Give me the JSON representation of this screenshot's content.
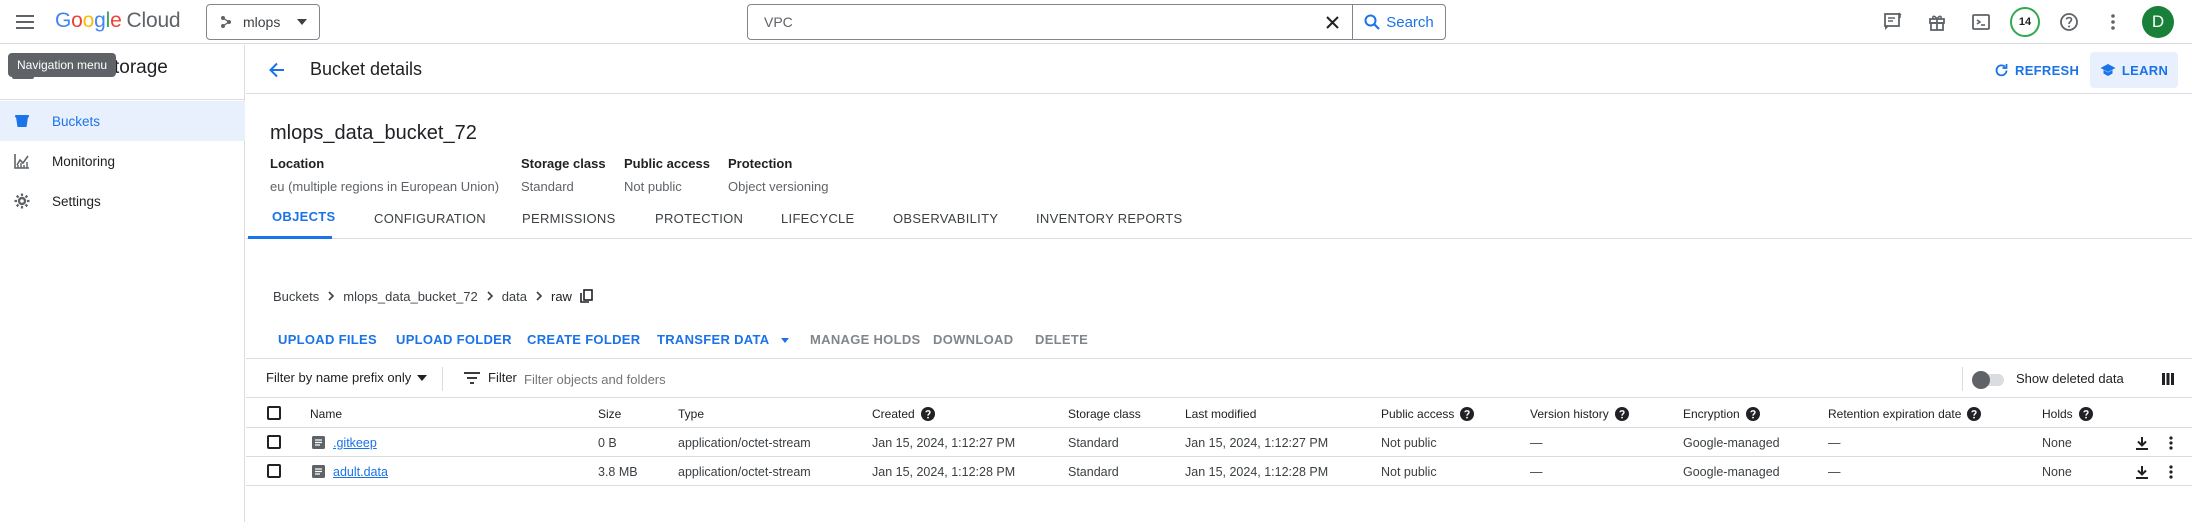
{
  "brand": {
    "google": [
      "G",
      "o",
      "o",
      "g",
      "l",
      "e"
    ],
    "product": "Cloud"
  },
  "project": {
    "name": "mlops"
  },
  "search": {
    "value": "VPC",
    "button_label": "Search"
  },
  "notifications": {
    "count": "14"
  },
  "user": {
    "initial": "D"
  },
  "tooltip": "Navigation menu",
  "sidebar": {
    "title": "Cloud Storage",
    "title_visible": "torage",
    "items": [
      {
        "label": "Buckets",
        "icon": "bucket-icon",
        "active": true
      },
      {
        "label": "Monitoring",
        "icon": "chart-icon",
        "active": false
      },
      {
        "label": "Settings",
        "icon": "gear-icon",
        "active": false
      }
    ]
  },
  "header": {
    "title": "Bucket details",
    "refresh_label": "REFRESH",
    "learn_label": "LEARN"
  },
  "bucket": {
    "name": "mlops_data_bucket_72",
    "location_label": "Location",
    "location_value": "eu (multiple regions in European Union)",
    "storage_class_label": "Storage class",
    "storage_class_value": "Standard",
    "public_access_label": "Public access",
    "public_access_value": "Not public",
    "protection_label": "Protection",
    "protection_value": "Object versioning"
  },
  "tabs": [
    "OBJECTS",
    "CONFIGURATION",
    "PERMISSIONS",
    "PROTECTION",
    "LIFECYCLE",
    "OBSERVABILITY",
    "INVENTORY REPORTS"
  ],
  "breadcrumb": [
    "Buckets",
    "mlops_data_bucket_72",
    "data",
    "raw"
  ],
  "actions": {
    "upload_files": "UPLOAD FILES",
    "upload_folder": "UPLOAD FOLDER",
    "create_folder": "CREATE FOLDER",
    "transfer_data": "TRANSFER DATA",
    "manage_holds": "MANAGE HOLDS",
    "download": "DOWNLOAD",
    "delete": "DELETE"
  },
  "filter": {
    "prefix_select": "Filter by name prefix only",
    "label": "Filter",
    "placeholder": "Filter objects and folders",
    "show_deleted": "Show deleted data"
  },
  "table": {
    "columns": [
      "Name",
      "Size",
      "Type",
      "Created",
      "Storage class",
      "Last modified",
      "Public access",
      "Version history",
      "Encryption",
      "Retention expiration date",
      "Holds"
    ],
    "rows": [
      {
        "name": ".gitkeep",
        "size": "0 B",
        "type": "application/octet-stream",
        "created": "Jan 15, 2024, 1:12:27 PM",
        "storage_class": "Standard",
        "last_modified": "Jan 15, 2024, 1:12:27 PM",
        "public_access": "Not public",
        "version_history": "—",
        "encryption": "Google-managed",
        "retention": "—",
        "holds": "None"
      },
      {
        "name": "adult.data",
        "size": "3.8 MB",
        "type": "application/octet-stream",
        "created": "Jan 15, 2024, 1:12:28 PM",
        "storage_class": "Standard",
        "last_modified": "Jan 15, 2024, 1:12:28 PM",
        "public_access": "Not public",
        "version_history": "—",
        "encryption": "Google-managed",
        "retention": "—",
        "holds": "None"
      }
    ]
  },
  "colors": {
    "accent": "#1a73e8",
    "active_bg": "#e8f0fe",
    "avatar": "#188038",
    "badge_ring": "#34a853"
  }
}
